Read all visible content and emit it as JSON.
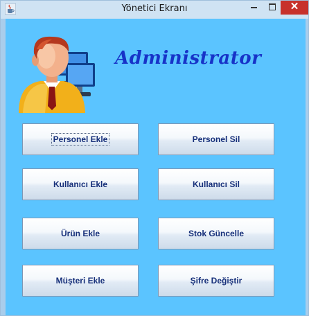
{
  "window": {
    "title": "Yönetici Ekranı",
    "close_glyph": "✕"
  },
  "header": {
    "heading": "Administrator"
  },
  "buttons": {
    "personel_ekle": "Personel Ekle",
    "personel_sil": "Personel Sil",
    "kullanici_ekle": "Kullanıcı Ekle",
    "kullanici_sil": "Kullanıcı Sil",
    "urun_ekle": "Ürün Ekle",
    "stok_guncelle": "Stok Güncelle",
    "musteri_ekle": "Müşteri Ekle",
    "sifre_degistir": "Şifre Değiştir"
  },
  "colors": {
    "panel_background": "#5bc4ff",
    "heading_color": "#1733c8",
    "button_text": "#17307a",
    "close_button": "#c7312b"
  },
  "icons": {
    "app": "java-cup-icon",
    "avatar": "administrator-avatar-icon"
  }
}
